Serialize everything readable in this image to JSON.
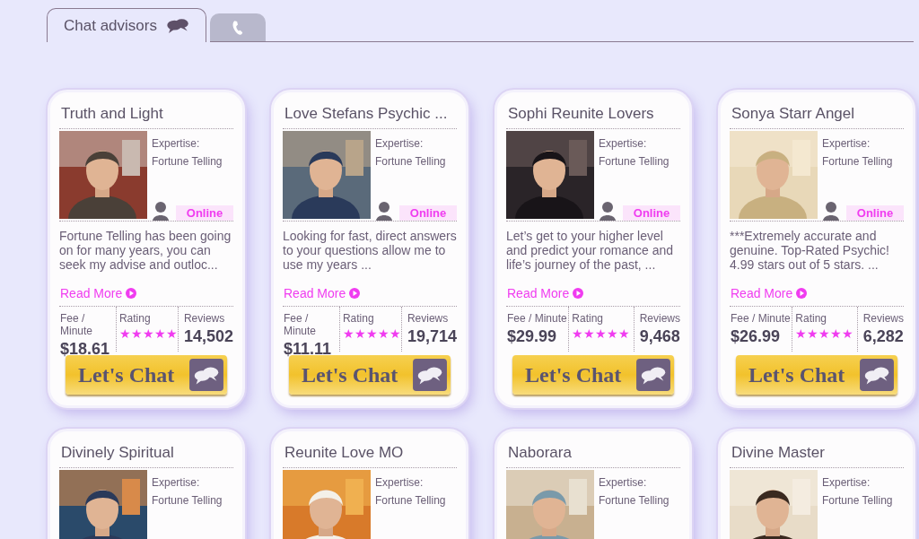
{
  "tabs": [
    {
      "label": "Chat advisors",
      "kind": "chat",
      "selected": true
    },
    {
      "kind": "phone",
      "selected": false
    }
  ],
  "advisors": [
    {
      "name": "Truth and Light",
      "expertise_label": "Expertise:",
      "expertise": "Fortune Telling",
      "status": "Online",
      "online": true,
      "description": "Fortune Telling has been going on for many years, you can seek my advise and outloc...",
      "read_more": "Read More",
      "fee_label": "Fee / Minute",
      "fee": "$18.61",
      "rating_label": "Rating",
      "stars": 5,
      "reviews_label": "Reviews",
      "reviews": "14,502",
      "button": "Let's Chat"
    },
    {
      "name": "Love Stefans Psychic ...",
      "expertise_label": "Expertise:",
      "expertise": "Fortune Telling",
      "status": "Online",
      "online": true,
      "description": "Looking for fast, direct answers to your questions allow me to use my years ...",
      "read_more": "Read More",
      "fee_label": "Fee / Minute",
      "fee": "$11.11",
      "rating_label": "Rating",
      "stars": 5,
      "reviews_label": "Reviews",
      "reviews": "19,714",
      "button": "Let's Chat"
    },
    {
      "name": "Sophi Reunite Lovers",
      "expertise_label": "Expertise:",
      "expertise": "Fortune Telling",
      "status": "Online",
      "online": true,
      "description": "Let’s get to your higher level and predict your romance and life’s journey of the past, ...",
      "read_more": "Read More",
      "fee_label": "Fee / Minute",
      "fee": "$29.99",
      "rating_label": "Rating",
      "stars": 5,
      "reviews_label": "Reviews",
      "reviews": "9,468",
      "button": "Let's Chat"
    },
    {
      "name": "Sonya Starr Angel",
      "expertise_label": "Expertise:",
      "expertise": "Fortune Telling",
      "status": "Online",
      "online": true,
      "description": "***Extremely accurate and genuine. Top-Rated Psychic! 4.99 stars out of 5 stars. ...",
      "read_more": "Read More",
      "fee_label": "Fee / Minute",
      "fee": "$26.99",
      "rating_label": "Rating",
      "stars": 5,
      "reviews_label": "Reviews",
      "reviews": "6,282",
      "button": "Let's Chat"
    },
    {
      "name": "Divinely Spiritual",
      "expertise_label": "Expertise:",
      "expertise": "Fortune Telling"
    },
    {
      "name": "Reunite Love MO",
      "expertise_label": "Expertise:",
      "expertise": "Fortune Telling"
    },
    {
      "name": "Naborara",
      "expertise_label": "Expertise:",
      "expertise": "Fortune Telling"
    },
    {
      "name": "Divine Master",
      "expertise_label": "Expertise:",
      "expertise": "Fortune Telling"
    }
  ]
}
